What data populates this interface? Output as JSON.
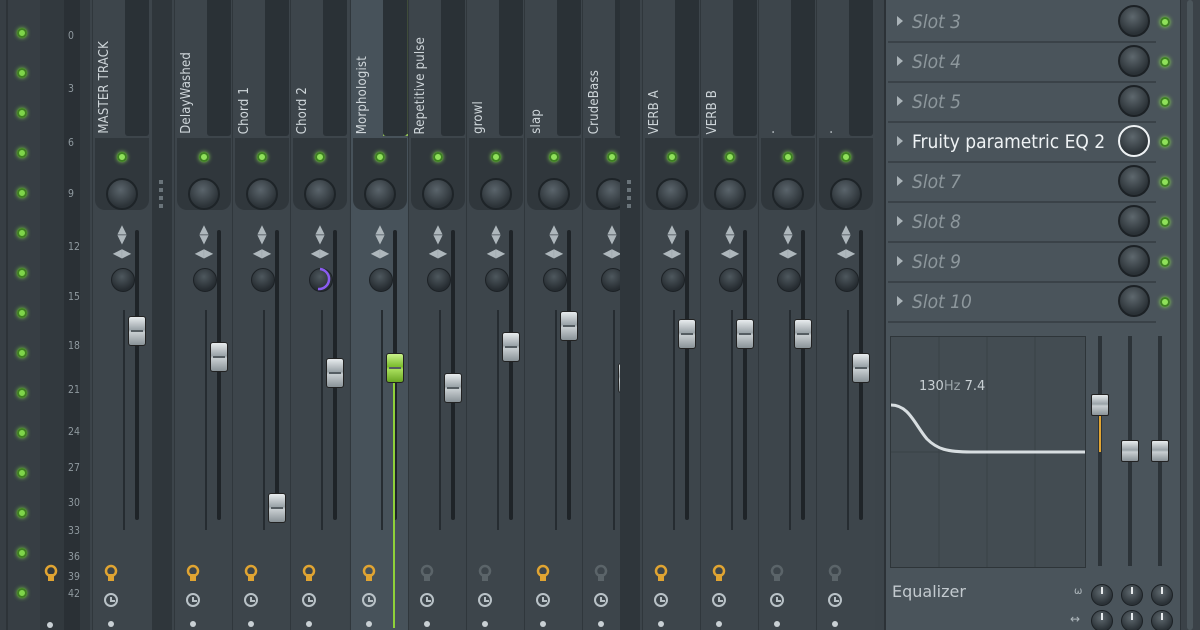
{
  "meter_scale": {
    "ticks": [
      "0",
      "3",
      "6",
      "9",
      "12",
      "15",
      "18",
      "21",
      "24",
      "27",
      "30",
      "33",
      "36",
      "39",
      "42"
    ]
  },
  "tracks": [
    {
      "name": "MASTER TRACK",
      "fader_level": 0.88
    },
    {
      "name": "DelayWashed",
      "fader_level": 0.78
    },
    {
      "name": "Chord 1",
      "fader_level": 0.2
    },
    {
      "name": "Chord 2",
      "fader_level": 0.72
    },
    {
      "name": "Morphologist",
      "fader_level": 0.74,
      "selected": true
    },
    {
      "name": "Repetitive pulse",
      "fader_level": 0.66
    },
    {
      "name": "growl",
      "fader_level": 0.82
    },
    {
      "name": "slap",
      "fader_level": 0.9
    },
    {
      "name": "CrudeBass",
      "fader_level": 0.7
    },
    {
      "name": "VERB A",
      "fader_level": 0.87
    },
    {
      "name": "VERB B",
      "fader_level": 0.87
    },
    {
      "name": ".",
      "fader_level": 0.87
    },
    {
      "name": ".",
      "fader_level": 0.74
    }
  ],
  "fx_slots": [
    {
      "label": "Slot 3",
      "active": false
    },
    {
      "label": "Slot 4",
      "active": false
    },
    {
      "label": "Slot 5",
      "active": false
    },
    {
      "label": "Fruity parametric EQ 2",
      "active": true
    },
    {
      "label": "Slot 7",
      "active": false
    },
    {
      "label": "Slot 8",
      "active": false
    },
    {
      "label": "Slot 9",
      "active": false
    },
    {
      "label": "Slot 10",
      "active": false
    }
  ],
  "equalizer": {
    "freq_value": "130",
    "freq_unit": "Hz",
    "gain_value": "7.4",
    "footer_label": "Equalizer"
  },
  "colors": {
    "led_green": "#8fe05a",
    "selected_fader": "#7bbd2d",
    "fx_lock_on": "#e0a432",
    "send_knob_purple": "#8a5cf0"
  }
}
